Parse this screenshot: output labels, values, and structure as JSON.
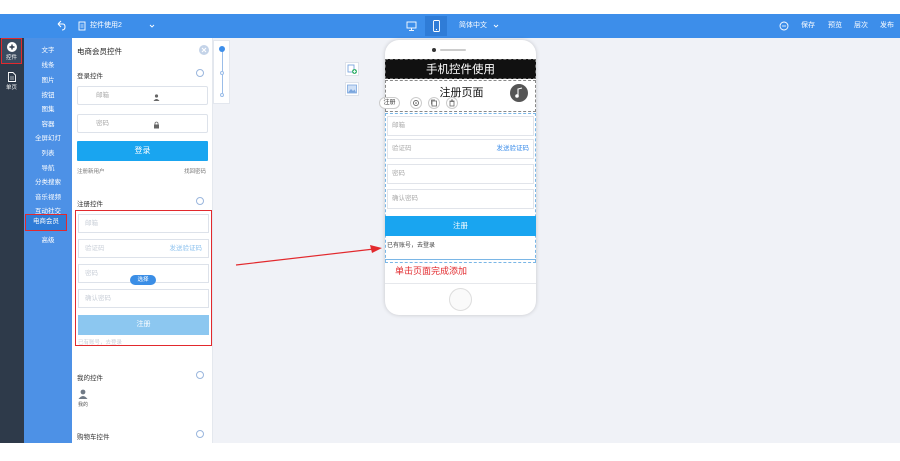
{
  "topbar": {
    "doc_title": "控件使用2",
    "language": "简体中文",
    "actions": [
      "保存",
      "预览",
      "层次",
      "发布"
    ]
  },
  "rail": {
    "items": [
      {
        "label": "控件",
        "icon": "plus-circle-icon"
      },
      {
        "label": "单页",
        "icon": "page-icon"
      }
    ]
  },
  "nav": {
    "items": [
      "文字",
      "线条",
      "图片",
      "按钮",
      "图集",
      "容器",
      "全屏幻灯",
      "列表",
      "导航",
      "分类搜索",
      "音乐视频",
      "互动社交",
      "电商会员",
      "高级"
    ],
    "active": "电商会员"
  },
  "panel": {
    "title": "电商会员控件",
    "login": {
      "heading": "登录控件",
      "email_placeholder": "邮箱",
      "password_placeholder": "密码",
      "login_button": "登录",
      "register_link": "注册新用户",
      "forgot_link": "找回密码"
    },
    "register": {
      "heading": "注册控件",
      "email": "邮箱",
      "code": "验证码",
      "send_code": "发送验证码",
      "password": "密码",
      "confirm": "确认密码",
      "select_badge": "选择",
      "submit": "注册",
      "footer": "已有账号，去登录"
    },
    "mine": {
      "heading": "我的控件",
      "item": "我的"
    },
    "cart": {
      "heading": "购物车控件"
    }
  },
  "phone": {
    "header_title": "手机控件使用",
    "page_title": "注册页面",
    "toolbar_label": "注册",
    "fields": [
      "邮箱",
      "验证码",
      "密码",
      "确认密码"
    ],
    "send_code": "发送验证码",
    "submit": "注册",
    "login_hint": "已有账号，去登录",
    "hint": "单击页面完成添加"
  },
  "colors": {
    "topbar": "#3d8eea",
    "primary_button": "#19a5f0",
    "highlight": "#e2292d",
    "rail": "#2e3a4a",
    "nav": "#4d91e6"
  }
}
